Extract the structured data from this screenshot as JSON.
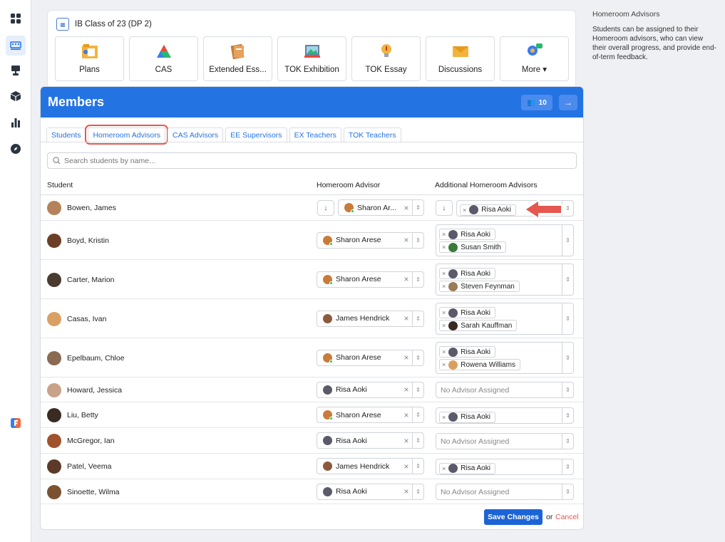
{
  "rail": {
    "items": [
      "dashboard-icon",
      "classes-icon",
      "presentation-icon",
      "cube-icon",
      "chart-icon",
      "compass-icon",
      "app-logo-icon"
    ]
  },
  "modules": {
    "class_title": "IB Class of 23 (DP 2)",
    "tiles": [
      {
        "label": "Plans",
        "icon": "plans-icon"
      },
      {
        "label": "CAS",
        "icon": "cas-icon"
      },
      {
        "label": "Extended Ess...",
        "icon": "extended-essay-icon"
      },
      {
        "label": "TOK Exhibition",
        "icon": "tok-exhibition-icon"
      },
      {
        "label": "TOK Essay",
        "icon": "tok-essay-icon"
      },
      {
        "label": "Discussions",
        "icon": "discussions-icon"
      },
      {
        "label": "More",
        "icon": "more-icon"
      }
    ]
  },
  "members": {
    "title": "Members",
    "count": "10",
    "tabs": [
      "Students",
      "Homeroom Advisors",
      "CAS Advisors",
      "EE Supervisors",
      "EX Teachers",
      "TOK Teachers"
    ],
    "active_tab": "Homeroom Advisors",
    "search_placeholder": "Search students by name...",
    "columns": {
      "student": "Student",
      "advisor": "Homeroom Advisor",
      "additional": "Additional Homeroom Advisors"
    },
    "no_advisor_text": "No Advisor Assigned",
    "rows": [
      {
        "student": "Bowen, James",
        "advisor": "Sharon Ar...",
        "additional": [
          "Risa Aoki"
        ]
      },
      {
        "student": "Boyd, Kristin",
        "advisor": "Sharon Arese",
        "additional": [
          "Risa Aoki",
          "Susan Smith"
        ]
      },
      {
        "student": "Carter, Marion",
        "advisor": "Sharon Arese",
        "additional": [
          "Risa Aoki",
          "Steven Feynman"
        ]
      },
      {
        "student": "Casas, Ivan",
        "advisor": "James Hendrick",
        "additional": [
          "Risa Aoki",
          "Sarah Kauffman"
        ]
      },
      {
        "student": "Epelbaum, Chloe",
        "advisor": "Sharon Arese",
        "additional": [
          "Risa Aoki",
          "Rowena Williams"
        ]
      },
      {
        "student": "Howard, Jessica",
        "advisor": "Risa Aoki",
        "additional": []
      },
      {
        "student": "Liu, Betty",
        "advisor": "Sharon Arese",
        "additional": [
          "Risa Aoki"
        ]
      },
      {
        "student": "McGregor, Ian",
        "advisor": "Risa Aoki",
        "additional": []
      },
      {
        "student": "Patel, Veema",
        "advisor": "James Hendrick",
        "additional": [
          "Risa Aoki"
        ]
      },
      {
        "student": "Sinoette, Wilma",
        "advisor": "Risa Aoki",
        "additional": []
      }
    ],
    "save_label": "Save Changes",
    "or_label": "or",
    "cancel_label": "Cancel"
  },
  "info": {
    "title": "Homeroom Advisors",
    "body": "Students can be assigned to their Homeroom advisors, who can view their overall progress, and provide end-of-term feedback."
  },
  "colors": {
    "accent": "#2473e3",
    "highlight": "#e5574f",
    "online": "#2ec45a"
  }
}
